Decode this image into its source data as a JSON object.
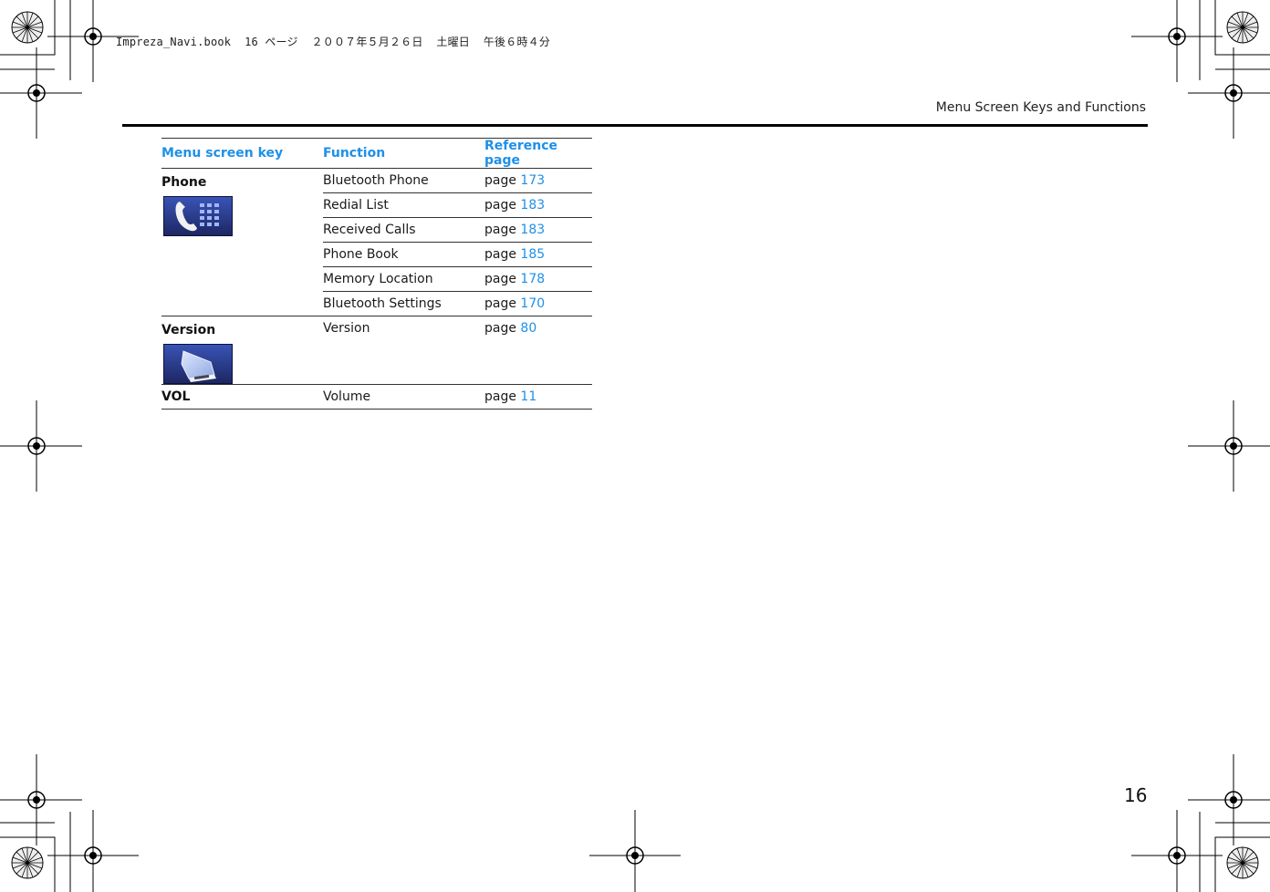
{
  "print_header": "Impreza_Navi.book  16 ページ  ２００７年５月２６日  土曜日  午後６時４分",
  "section_title": "Menu Screen Keys and Functions",
  "page_number": "16",
  "table": {
    "headers": [
      "Menu screen key",
      "Function",
      "Reference page"
    ],
    "groups": [
      {
        "key": "Phone",
        "icon": "phone-keypad-icon",
        "rows": [
          {
            "function": "Bluetooth Phone",
            "ref_prefix": "page ",
            "ref_num": "173"
          },
          {
            "function": "Redial List",
            "ref_prefix": "page ",
            "ref_num": "183"
          },
          {
            "function": "Received Calls",
            "ref_prefix": "page ",
            "ref_num": "183"
          },
          {
            "function": "Phone Book",
            "ref_prefix": "page ",
            "ref_num": "185"
          },
          {
            "function": "Memory Location",
            "ref_prefix": "page ",
            "ref_num": "178"
          },
          {
            "function": "Bluetooth Settings",
            "ref_prefix": "page ",
            "ref_num": "170"
          }
        ]
      },
      {
        "key": "Version",
        "icon": "version-card-icon",
        "rows": [
          {
            "function": "Version",
            "ref_prefix": "page ",
            "ref_num": "80"
          }
        ]
      },
      {
        "key": "VOL",
        "rows": [
          {
            "function": "Volume",
            "ref_prefix": "page ",
            "ref_num": "11"
          }
        ]
      }
    ]
  },
  "colors": {
    "accent": "#1e90e8",
    "text": "#1a1a1a",
    "icon_bg": "#2b3d8f"
  }
}
